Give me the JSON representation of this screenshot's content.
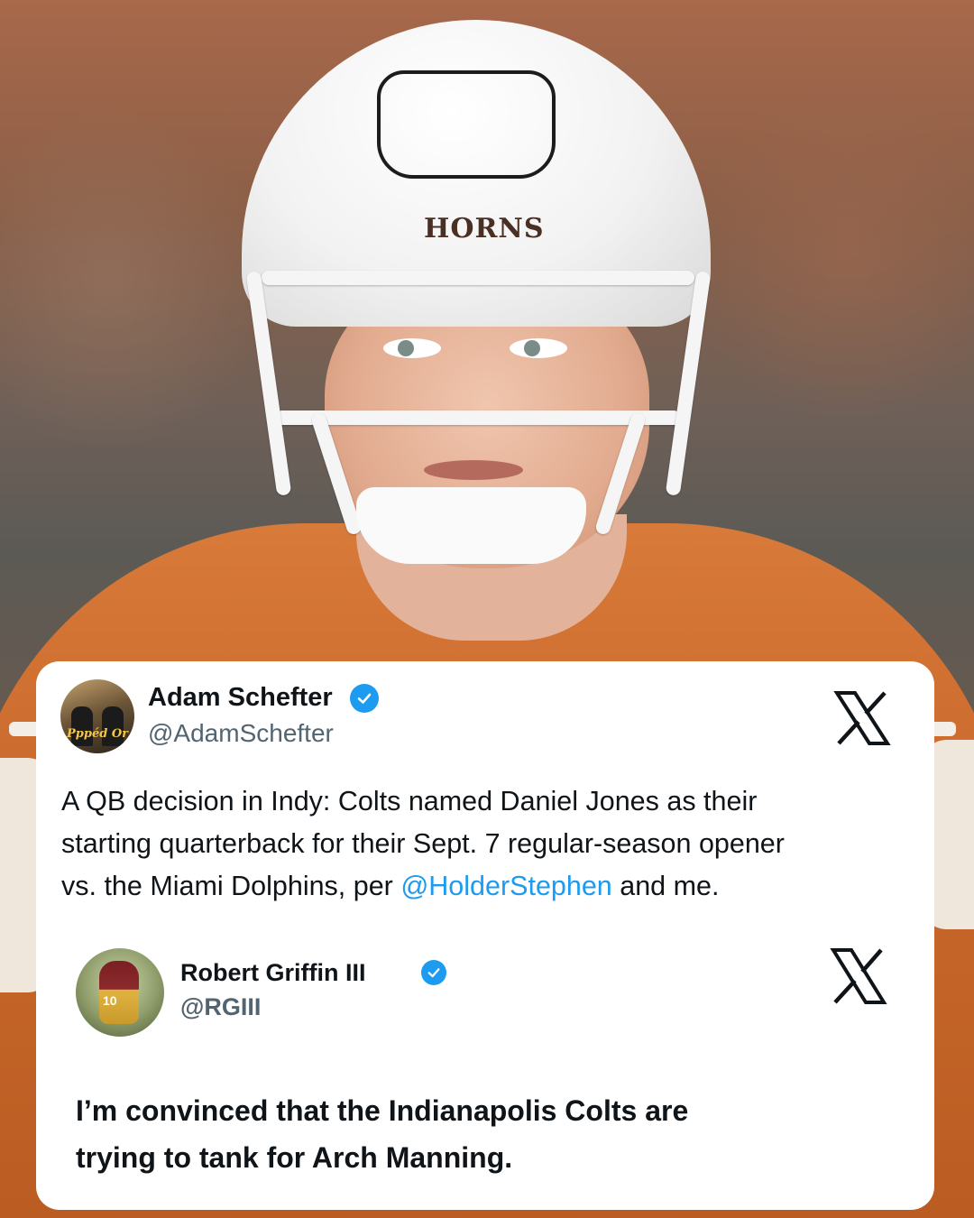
{
  "photo": {
    "helmet_text": "HORNS"
  },
  "tweet_1": {
    "avatar_caption": "Pppéd Or",
    "name": "Adam Schefter",
    "handle": "@AdamSchefter",
    "verified": true,
    "body_lines": [
      "A QB decision in Indy: Colts named Daniel Jones as their",
      "starting quarterback for their Sept. 7 regular-season opener",
      "vs. the Miami Dolphins, per "
    ],
    "mention": "@HolderStephen",
    "body_tail": " and me.",
    "logo_icon": "x-logo-icon"
  },
  "tweet_2": {
    "avatar_number": "10",
    "name": "Robert Griffin III",
    "handle": "@RGIII",
    "verified": true,
    "body_lines": [
      "I’m convinced that the Indianapolis Colts are",
      "trying to tank for Arch Manning."
    ],
    "logo_icon": "x-logo-icon"
  },
  "colors": {
    "card_bg": "#ffffff",
    "text_primary": "#0f1419",
    "text_secondary": "#536471",
    "link": "#1d9bf0",
    "verified_badge": "#1d9bf0",
    "jersey_orange": "#c9682b"
  }
}
